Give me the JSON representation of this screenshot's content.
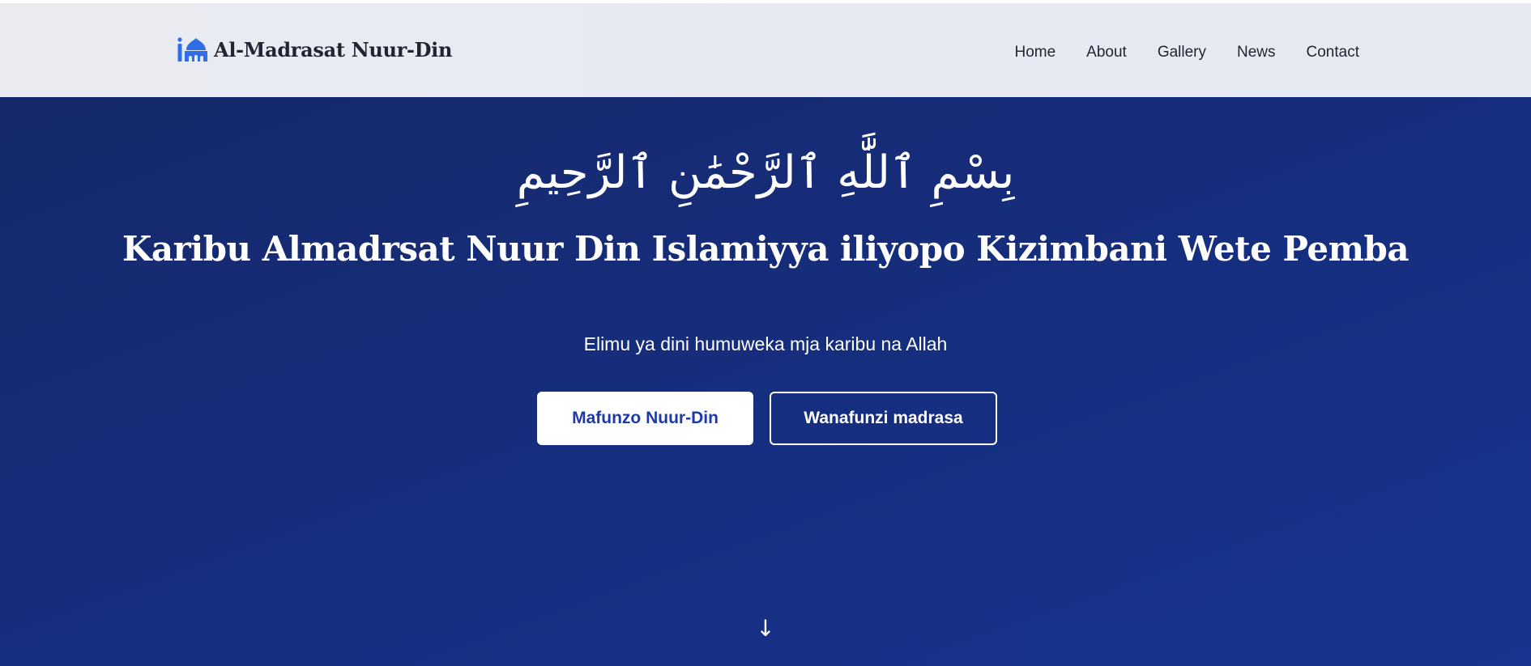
{
  "brand": {
    "icon": "mosque-icon",
    "name": "Al-Madrasat Nuur-Din",
    "accent_color": "#2f6ee6"
  },
  "nav": {
    "items": [
      {
        "label": "Home"
      },
      {
        "label": "About"
      },
      {
        "label": "Gallery"
      },
      {
        "label": "News"
      },
      {
        "label": "Contact"
      }
    ]
  },
  "hero": {
    "bismillah": "بِسْمِ ٱللَّٰهِ ٱلرَّحْمَٰنِ ٱلرَّحِيمِ",
    "title": "Karibu Almadrsat Nuur Din Islamiyya iliyopo Kizimbani Wete Pemba",
    "subtitle": "Elimu ya dini humuweka mja karibu na Allah",
    "primary_button": "Mafunzo Nuur-Din",
    "secondary_button": "Wanafunzi madrasa",
    "scroll_icon": "arrow-down-icon",
    "scroll_glyph": "↓",
    "background_color": "#162d7c",
    "primary_text_color": "#1c3aa8"
  }
}
